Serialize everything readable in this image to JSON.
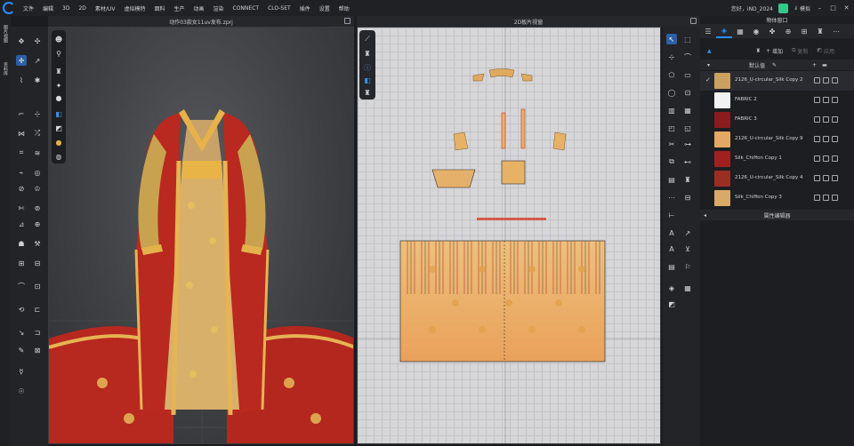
{
  "menu": {
    "items": [
      "文件",
      "编辑",
      "3D",
      "2D",
      "素材/UV",
      "虚拟模特",
      "面料",
      "生产",
      "动画",
      "渲染",
      "CONNECT",
      "CLO-SET",
      "插件",
      "设置",
      "帮助"
    ],
    "user": "您好，iND_2024",
    "mode": "模拟"
  },
  "vtabs": {
    "tab1": "图片视图",
    "tab2": "资料库"
  },
  "viewport3d": {
    "title": "动作03款女11uv发布.zprj"
  },
  "viewport2d": {
    "title": "2D板片视窗"
  },
  "objpanel": {
    "title": "物体窗口",
    "add_label": "增加",
    "copy_label": "复制",
    "apply_label": "应用",
    "default_label": "默认值",
    "property_editor": "属性编辑器",
    "fabrics": [
      {
        "name": "2126_U-circular_Silk Copy 2",
        "color": "#caa15f",
        "selected": true
      },
      {
        "name": "FABRIC 2",
        "color": "#f2f2f2",
        "selected": false
      },
      {
        "name": "FABRIC 3",
        "color": "#8b1b1e",
        "selected": false
      },
      {
        "name": "2126_U-circular_Silk Copy 9",
        "color": "#e2a864",
        "selected": false
      },
      {
        "name": "Silk_Chiffon Copy 1",
        "color": "#a21f1f",
        "selected": false
      },
      {
        "name": "2126_U-circular_Silk Copy 4",
        "color": "#9b2e22",
        "selected": false
      },
      {
        "name": "Silk_Chiffon Copy 3",
        "color": "#d8a968",
        "selected": false
      }
    ]
  }
}
